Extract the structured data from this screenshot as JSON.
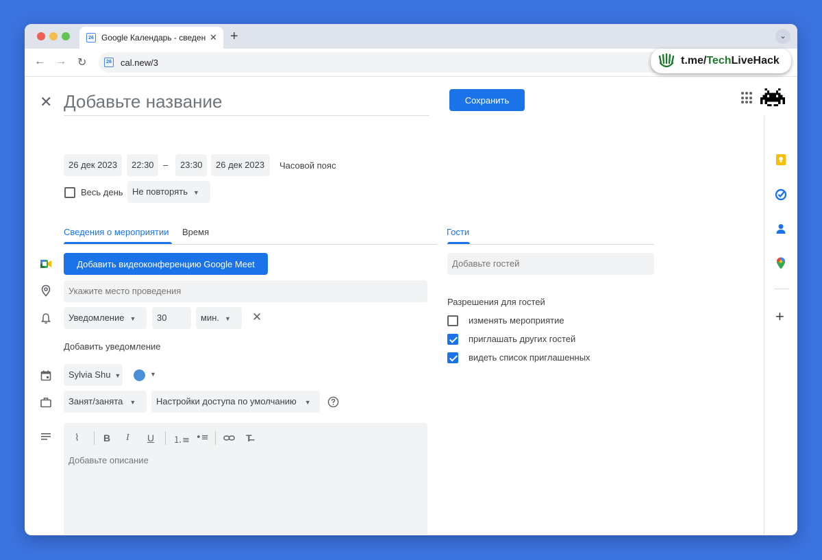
{
  "browser": {
    "tab_title": "Google Календарь - сведения",
    "favicon_text": "26",
    "url": "cal.new/3",
    "promo_prefix": "t.me/",
    "promo_tech": "Tech",
    "promo_rest": "LiveHack"
  },
  "event": {
    "title_placeholder": "Добавьте название",
    "save_label": "Сохранить",
    "start_date": "26 дек 2023",
    "start_time": "22:30",
    "dash": "–",
    "end_time": "23:30",
    "end_date": "26 дек 2023",
    "timezone_label": "Часовой пояс",
    "all_day_label": "Весь день",
    "all_day_checked": false,
    "repeat_value": "Не повторять"
  },
  "tabs": {
    "details": "Сведения о мероприятии",
    "time": "Время",
    "guests": "Гости"
  },
  "details": {
    "meet_button": "Добавить видеоконференцию Google Meet",
    "location_placeholder": "Укажите место проведения",
    "notification_type": "Уведомление",
    "notification_value": "30",
    "notification_unit": "мин.",
    "add_notification": "Добавить уведомление",
    "calendar_owner": "Sylvia Shu",
    "calendar_color": "#4a90d9",
    "busy_status": "Занят/занята",
    "visibility": "Настройки доступа по умолчанию",
    "description_placeholder": "Добавьте описание"
  },
  "guests": {
    "add_placeholder": "Добавьте гостей",
    "permissions_title": "Разрешения для гостей",
    "permissions": [
      {
        "label": "изменять мероприятие",
        "checked": false
      },
      {
        "label": "приглашать других гостей",
        "checked": true
      },
      {
        "label": "видеть список приглашенных",
        "checked": true
      }
    ]
  },
  "colors": {
    "accent": "#1a73e8",
    "page_background": "#3b73e0"
  }
}
